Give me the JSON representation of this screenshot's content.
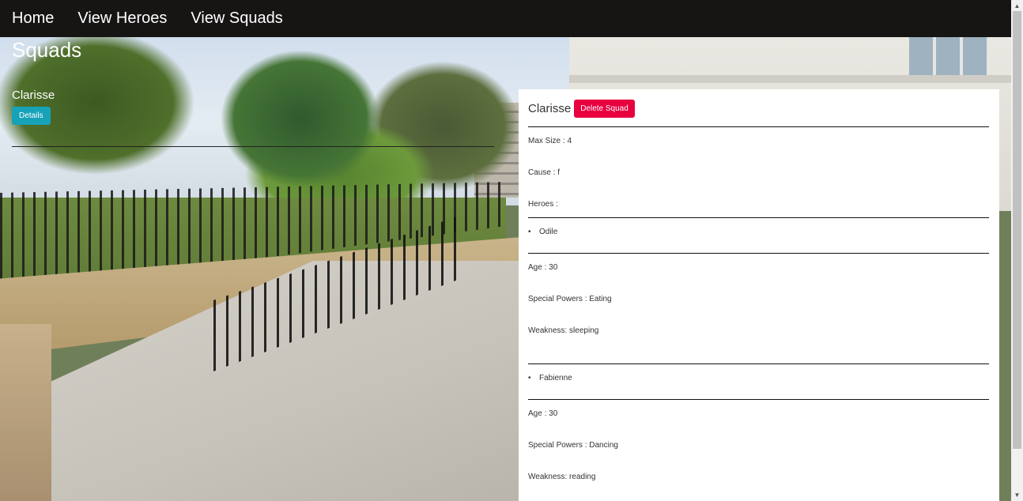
{
  "nav": {
    "items": [
      "Home",
      "View Heroes",
      "View Squads"
    ]
  },
  "page": {
    "title": "Squads"
  },
  "squads": [
    {
      "name": "Clarisse",
      "details_label": "Details"
    }
  ],
  "detail": {
    "name": "Clarisse",
    "delete_label": "Delete Squad",
    "max_size": "Max Size : 4",
    "cause": "Cause : f",
    "heroes_label": "Heroes :",
    "heroes": [
      {
        "name": "Odile",
        "age": "Age : 30",
        "powers": "Special Powers : Eating",
        "weakness": "Weakness: sleeping"
      },
      {
        "name": "Fabienne",
        "age": "Age : 30",
        "powers": "Special Powers : Dancing",
        "weakness": "Weakness: reading"
      }
    ]
  },
  "colors": {
    "navbar": "#171514",
    "details_button": "#17a2b8",
    "delete_button": "#e8003f"
  }
}
